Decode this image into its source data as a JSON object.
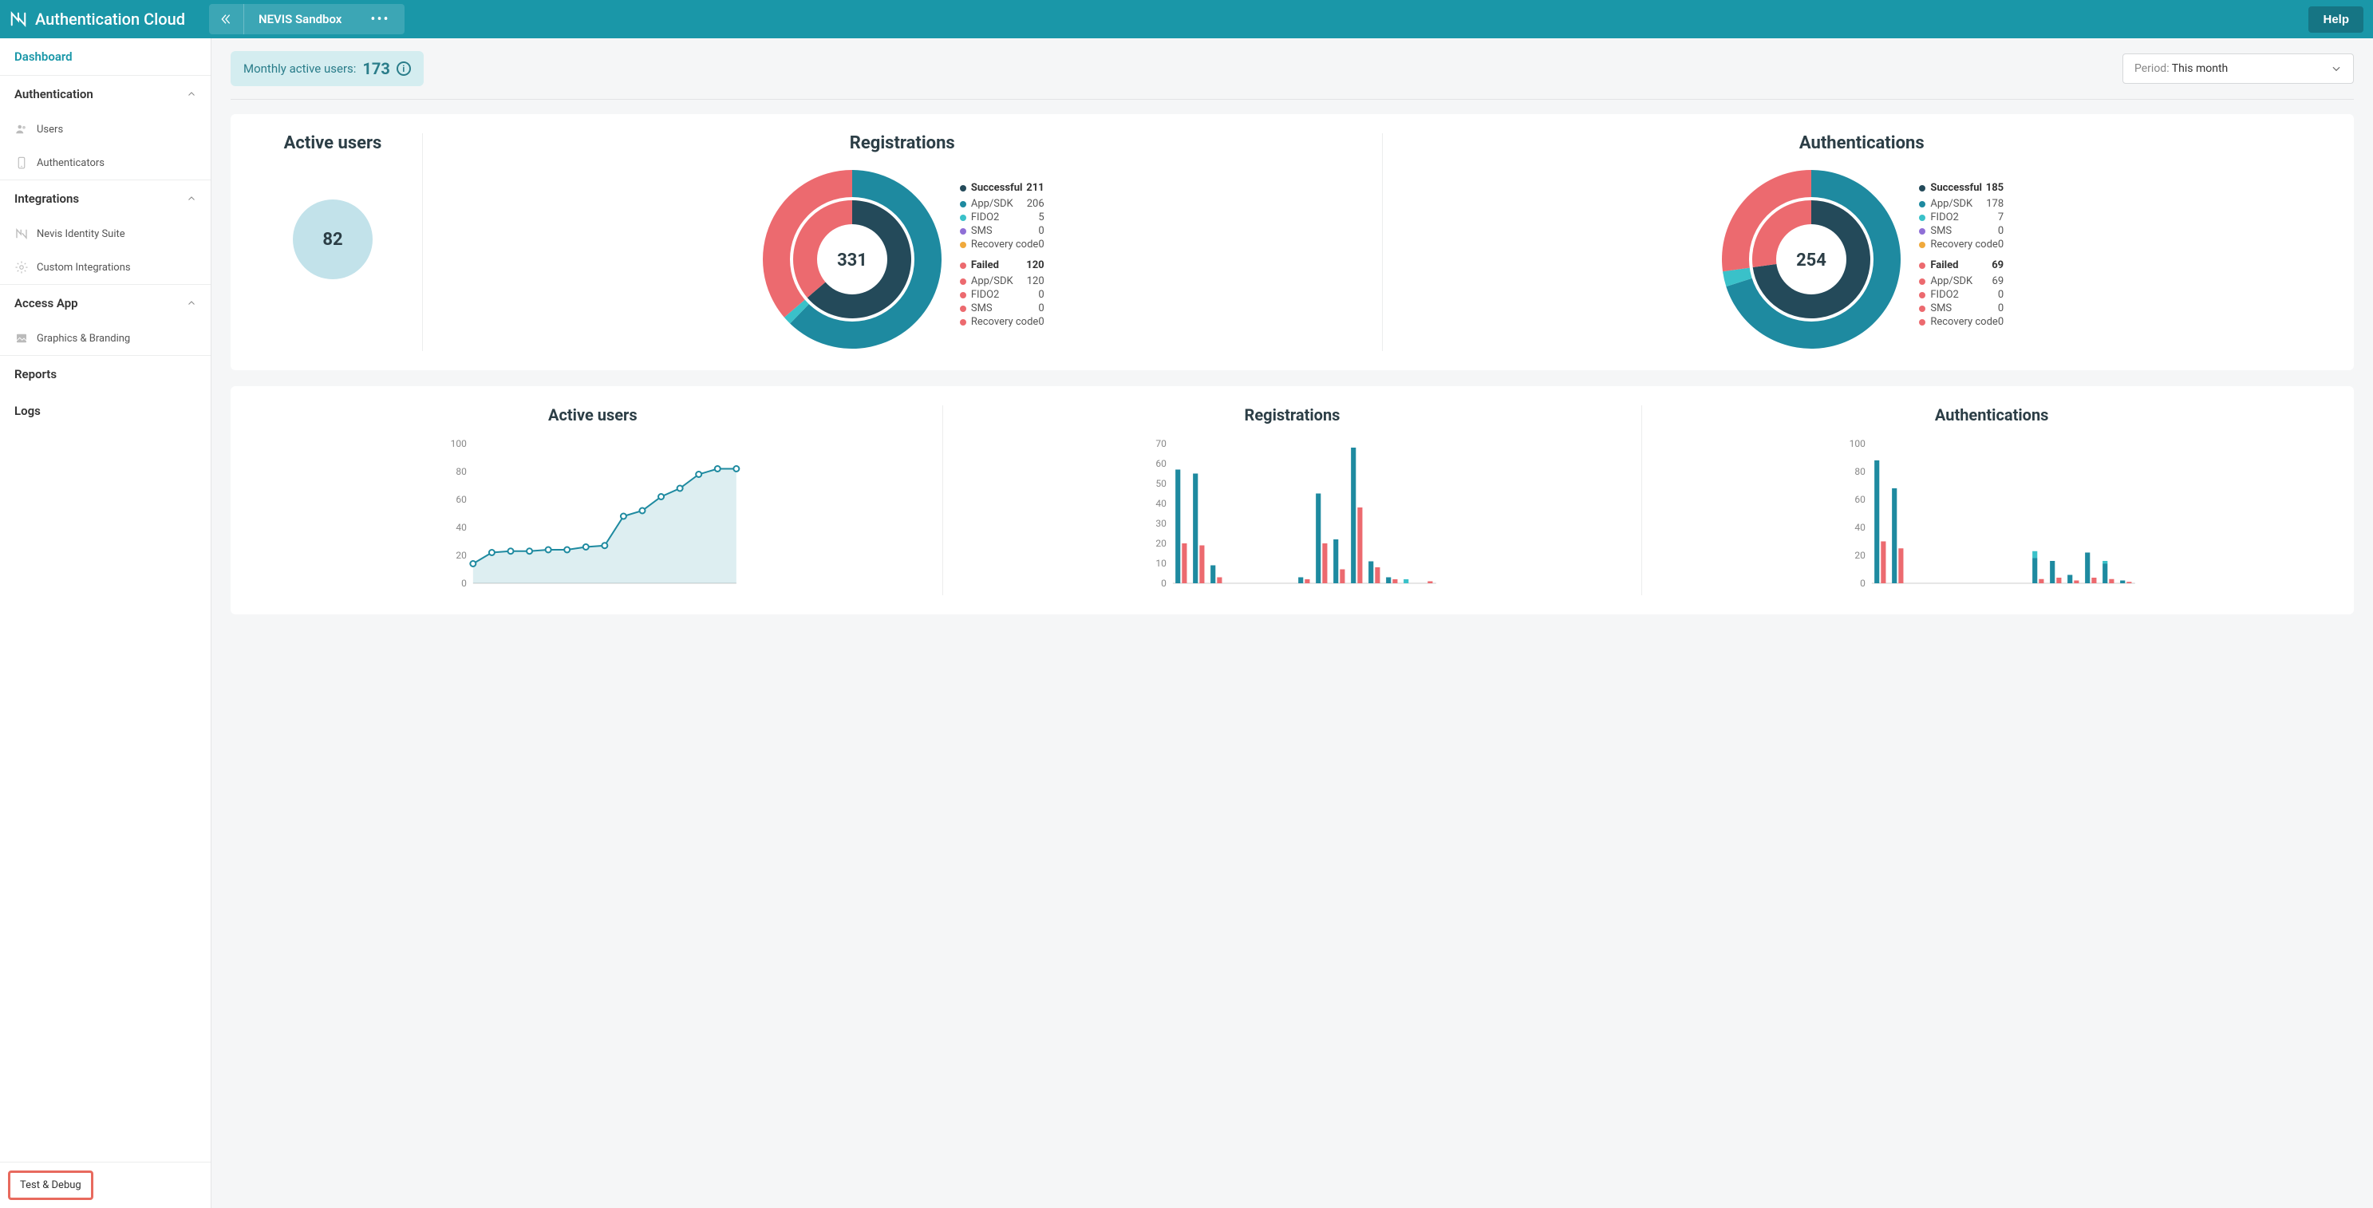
{
  "brand": "Authentication Cloud",
  "breadcrumb": {
    "title": "NEVIS Sandbox"
  },
  "help_label": "Help",
  "sidebar": {
    "dashboard": "Dashboard",
    "auth": {
      "label": "Authentication",
      "users": "Users",
      "authenticators": "Authenticators"
    },
    "integrations": {
      "label": "Integrations",
      "nis": "Nevis Identity Suite",
      "custom": "Custom Integrations"
    },
    "access_app": {
      "label": "Access App",
      "branding": "Graphics & Branding"
    },
    "reports": "Reports",
    "logs": "Logs",
    "test_debug": "Test & Debug"
  },
  "mau": {
    "label": "Monthly active users:",
    "value": "173"
  },
  "period": {
    "label": "Period:",
    "value": "This month"
  },
  "colors": {
    "teal": "#1e8aa0",
    "dark": "#244a5a",
    "red": "#ec6a6f",
    "cyan": "#3ac1c9",
    "purple": "#8f6fd6",
    "orange": "#f0a93c"
  },
  "donuts": {
    "active_users": {
      "title": "Active users",
      "value": "82"
    },
    "registrations": {
      "title": "Registrations",
      "center": "331",
      "success": {
        "label": "Successful",
        "total": "211",
        "items": [
          {
            "label": "App/SDK",
            "value": "206",
            "color": "#1e8aa0"
          },
          {
            "label": "FIDO2",
            "value": "5",
            "color": "#3ac1c9"
          },
          {
            "label": "SMS",
            "value": "0",
            "color": "#8f6fd6"
          },
          {
            "label": "Recovery code",
            "value": "0",
            "color": "#f0a93c"
          }
        ]
      },
      "failed": {
        "label": "Failed",
        "total": "120",
        "items": [
          {
            "label": "App/SDK",
            "value": "120",
            "color": "#ec6a6f"
          },
          {
            "label": "FIDO2",
            "value": "0",
            "color": "#ec6a6f"
          },
          {
            "label": "SMS",
            "value": "0",
            "color": "#ec6a6f"
          },
          {
            "label": "Recovery code",
            "value": "0",
            "color": "#ec6a6f"
          }
        ]
      }
    },
    "authentications": {
      "title": "Authentications",
      "center": "254",
      "success": {
        "label": "Successful",
        "total": "185",
        "items": [
          {
            "label": "App/SDK",
            "value": "178",
            "color": "#1e8aa0"
          },
          {
            "label": "FIDO2",
            "value": "7",
            "color": "#3ac1c9"
          },
          {
            "label": "SMS",
            "value": "0",
            "color": "#8f6fd6"
          },
          {
            "label": "Recovery code",
            "value": "0",
            "color": "#f0a93c"
          }
        ]
      },
      "failed": {
        "label": "Failed",
        "total": "69",
        "items": [
          {
            "label": "App/SDK",
            "value": "69",
            "color": "#ec6a6f"
          },
          {
            "label": "FIDO2",
            "value": "0",
            "color": "#ec6a6f"
          },
          {
            "label": "SMS",
            "value": "0",
            "color": "#ec6a6f"
          },
          {
            "label": "Recovery code",
            "value": "0",
            "color": "#ec6a6f"
          }
        ]
      }
    }
  },
  "chart_data": [
    {
      "id": "active_users_line",
      "type": "line",
      "title": "Active users",
      "ylim": [
        0,
        100
      ],
      "yticks": [
        0,
        20,
        40,
        60,
        80,
        100
      ],
      "values": [
        14,
        22,
        23,
        23,
        24,
        24,
        26,
        27,
        48,
        52,
        62,
        68,
        78,
        82,
        82
      ]
    },
    {
      "id": "registrations_bar",
      "type": "bar",
      "title": "Registrations",
      "ylim": [
        0,
        70
      ],
      "yticks": [
        0,
        10,
        20,
        30,
        40,
        50,
        60,
        70
      ],
      "series": [
        {
          "name": "Successful App/SDK",
          "color": "#1e8aa0",
          "values": [
            57,
            55,
            9,
            0,
            0,
            0,
            0,
            3,
            45,
            22,
            68,
            11,
            3,
            0,
            0
          ]
        },
        {
          "name": "Successful FIDO2",
          "color": "#3ac1c9",
          "values": [
            0,
            0,
            0,
            0,
            0,
            0,
            0,
            0,
            0,
            0,
            0,
            0,
            0,
            2,
            0
          ]
        },
        {
          "name": "Failed App/SDK",
          "color": "#ec6a6f",
          "values": [
            20,
            19,
            3,
            0,
            0,
            0,
            0,
            2,
            20,
            7,
            38,
            8,
            2,
            0,
            1
          ]
        }
      ]
    },
    {
      "id": "authentications_bar",
      "type": "bar",
      "title": "Authentications",
      "ylim": [
        0,
        100
      ],
      "yticks": [
        0,
        20,
        40,
        60,
        80,
        100
      ],
      "series": [
        {
          "name": "Successful App/SDK",
          "color": "#1e8aa0",
          "values": [
            88,
            68,
            0,
            0,
            0,
            0,
            0,
            0,
            0,
            18,
            16,
            6,
            22,
            14,
            2
          ]
        },
        {
          "name": "Successful FIDO2",
          "color": "#3ac1c9",
          "values": [
            0,
            0,
            0,
            0,
            0,
            0,
            0,
            0,
            0,
            5,
            0,
            0,
            0,
            2,
            0
          ]
        },
        {
          "name": "Failed App/SDK",
          "color": "#ec6a6f",
          "values": [
            30,
            25,
            0,
            0,
            0,
            0,
            0,
            0,
            0,
            3,
            4,
            2,
            4,
            3,
            1
          ]
        }
      ]
    }
  ]
}
